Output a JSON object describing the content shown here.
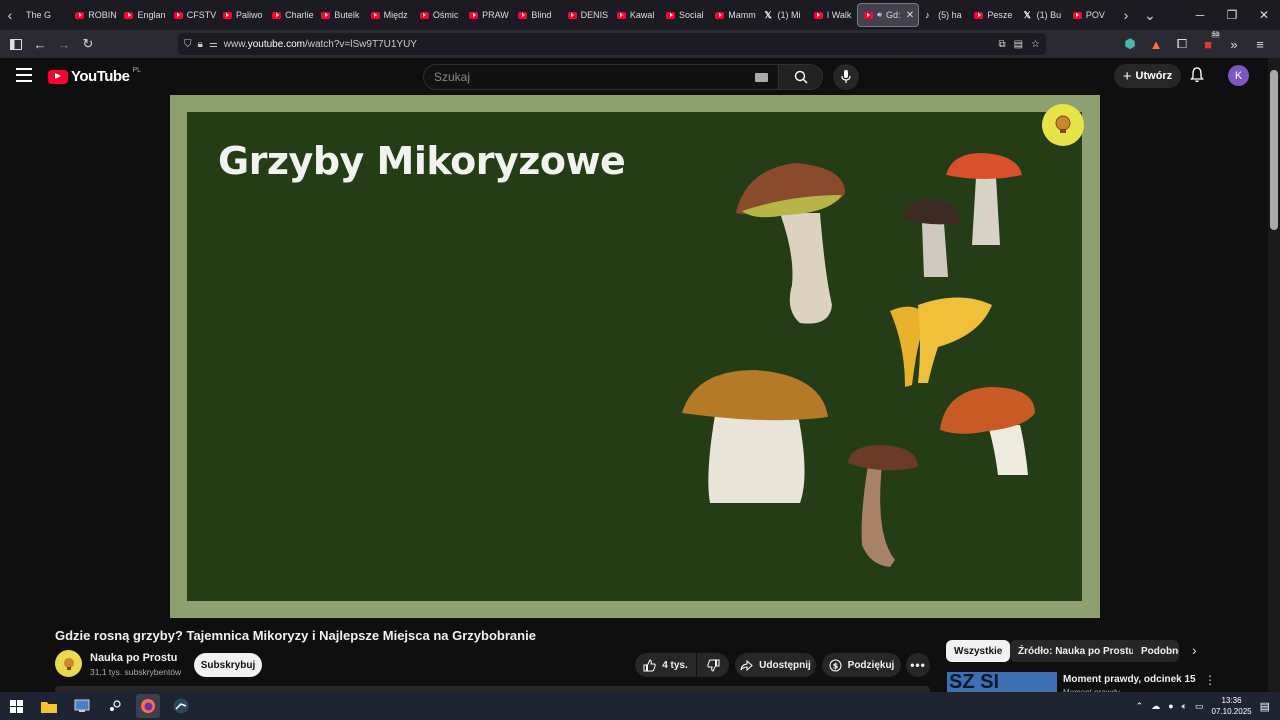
{
  "browser": {
    "tabs": [
      {
        "label": "The G",
        "icon": "none"
      },
      {
        "label": "ROBIN",
        "icon": "youtube"
      },
      {
        "label": "Englan",
        "icon": "youtube"
      },
      {
        "label": "CFSTV",
        "icon": "youtube"
      },
      {
        "label": "Paliwo",
        "icon": "youtube"
      },
      {
        "label": "Charlie",
        "icon": "youtube"
      },
      {
        "label": "Butelk",
        "icon": "youtube"
      },
      {
        "label": "Międz",
        "icon": "youtube"
      },
      {
        "label": "Ośmic",
        "icon": "youtube"
      },
      {
        "label": "PRAW",
        "icon": "youtube"
      },
      {
        "label": "Blind",
        "icon": "youtube"
      },
      {
        "label": "DENIS",
        "icon": "youtube"
      },
      {
        "label": "Kawal",
        "icon": "youtube"
      },
      {
        "label": "Social",
        "icon": "youtube"
      },
      {
        "label": "Mamm",
        "icon": "youtube"
      },
      {
        "label": "(1) Mi",
        "icon": "x"
      },
      {
        "label": "I Walk",
        "icon": "youtube"
      },
      {
        "label": "Gd:",
        "icon": "youtube",
        "active": true
      },
      {
        "label": "(5) ha",
        "icon": "tiktok"
      },
      {
        "label": "Pesze",
        "icon": "youtube"
      },
      {
        "label": "(1) Bu",
        "icon": "x"
      },
      {
        "label": "POV",
        "icon": "youtube"
      }
    ],
    "url_prefix": "www.",
    "url_domain": "youtube.com",
    "url_path": "/watch?v=lSw9T7U1YUY",
    "extension_badge": "53"
  },
  "youtube": {
    "logo_text": "YouTube",
    "logo_region": "PL",
    "search_placeholder": "Szukaj",
    "create_label": "Utwórz",
    "avatar_letter": "K"
  },
  "video": {
    "slide_title": "Grzyby Mikoryzowe",
    "title": "Gdzie rosną grzyby? Tajemnica Mikoryzy i Najlepsze Miejsca na Grzybobranie",
    "channel_name": "Nauka po Prostu",
    "channel_subs": "31,1 tys. subskrybentów",
    "subscribe_label": "Subskrybuj",
    "likes": "4 tys.",
    "share_label": "Udostępnij",
    "thanks_label": "Podziękuj"
  },
  "sidebar": {
    "chips": [
      "Wszystkie",
      "Źródło: Nauka po Prostu",
      "Podobne"
    ],
    "rec_title": "Moment prawdy, odcinek 15",
    "rec_channel": "Moment prawdy",
    "rec_thumb_text": "SZ SI"
  },
  "taskbar": {
    "time": "13:36",
    "date": "07.10.2025"
  },
  "colors": {
    "youtube_red": "#ff0033",
    "slide_bg": "#243d17",
    "slide_frame": "#8ea070",
    "avatar": "#7e57c2"
  }
}
